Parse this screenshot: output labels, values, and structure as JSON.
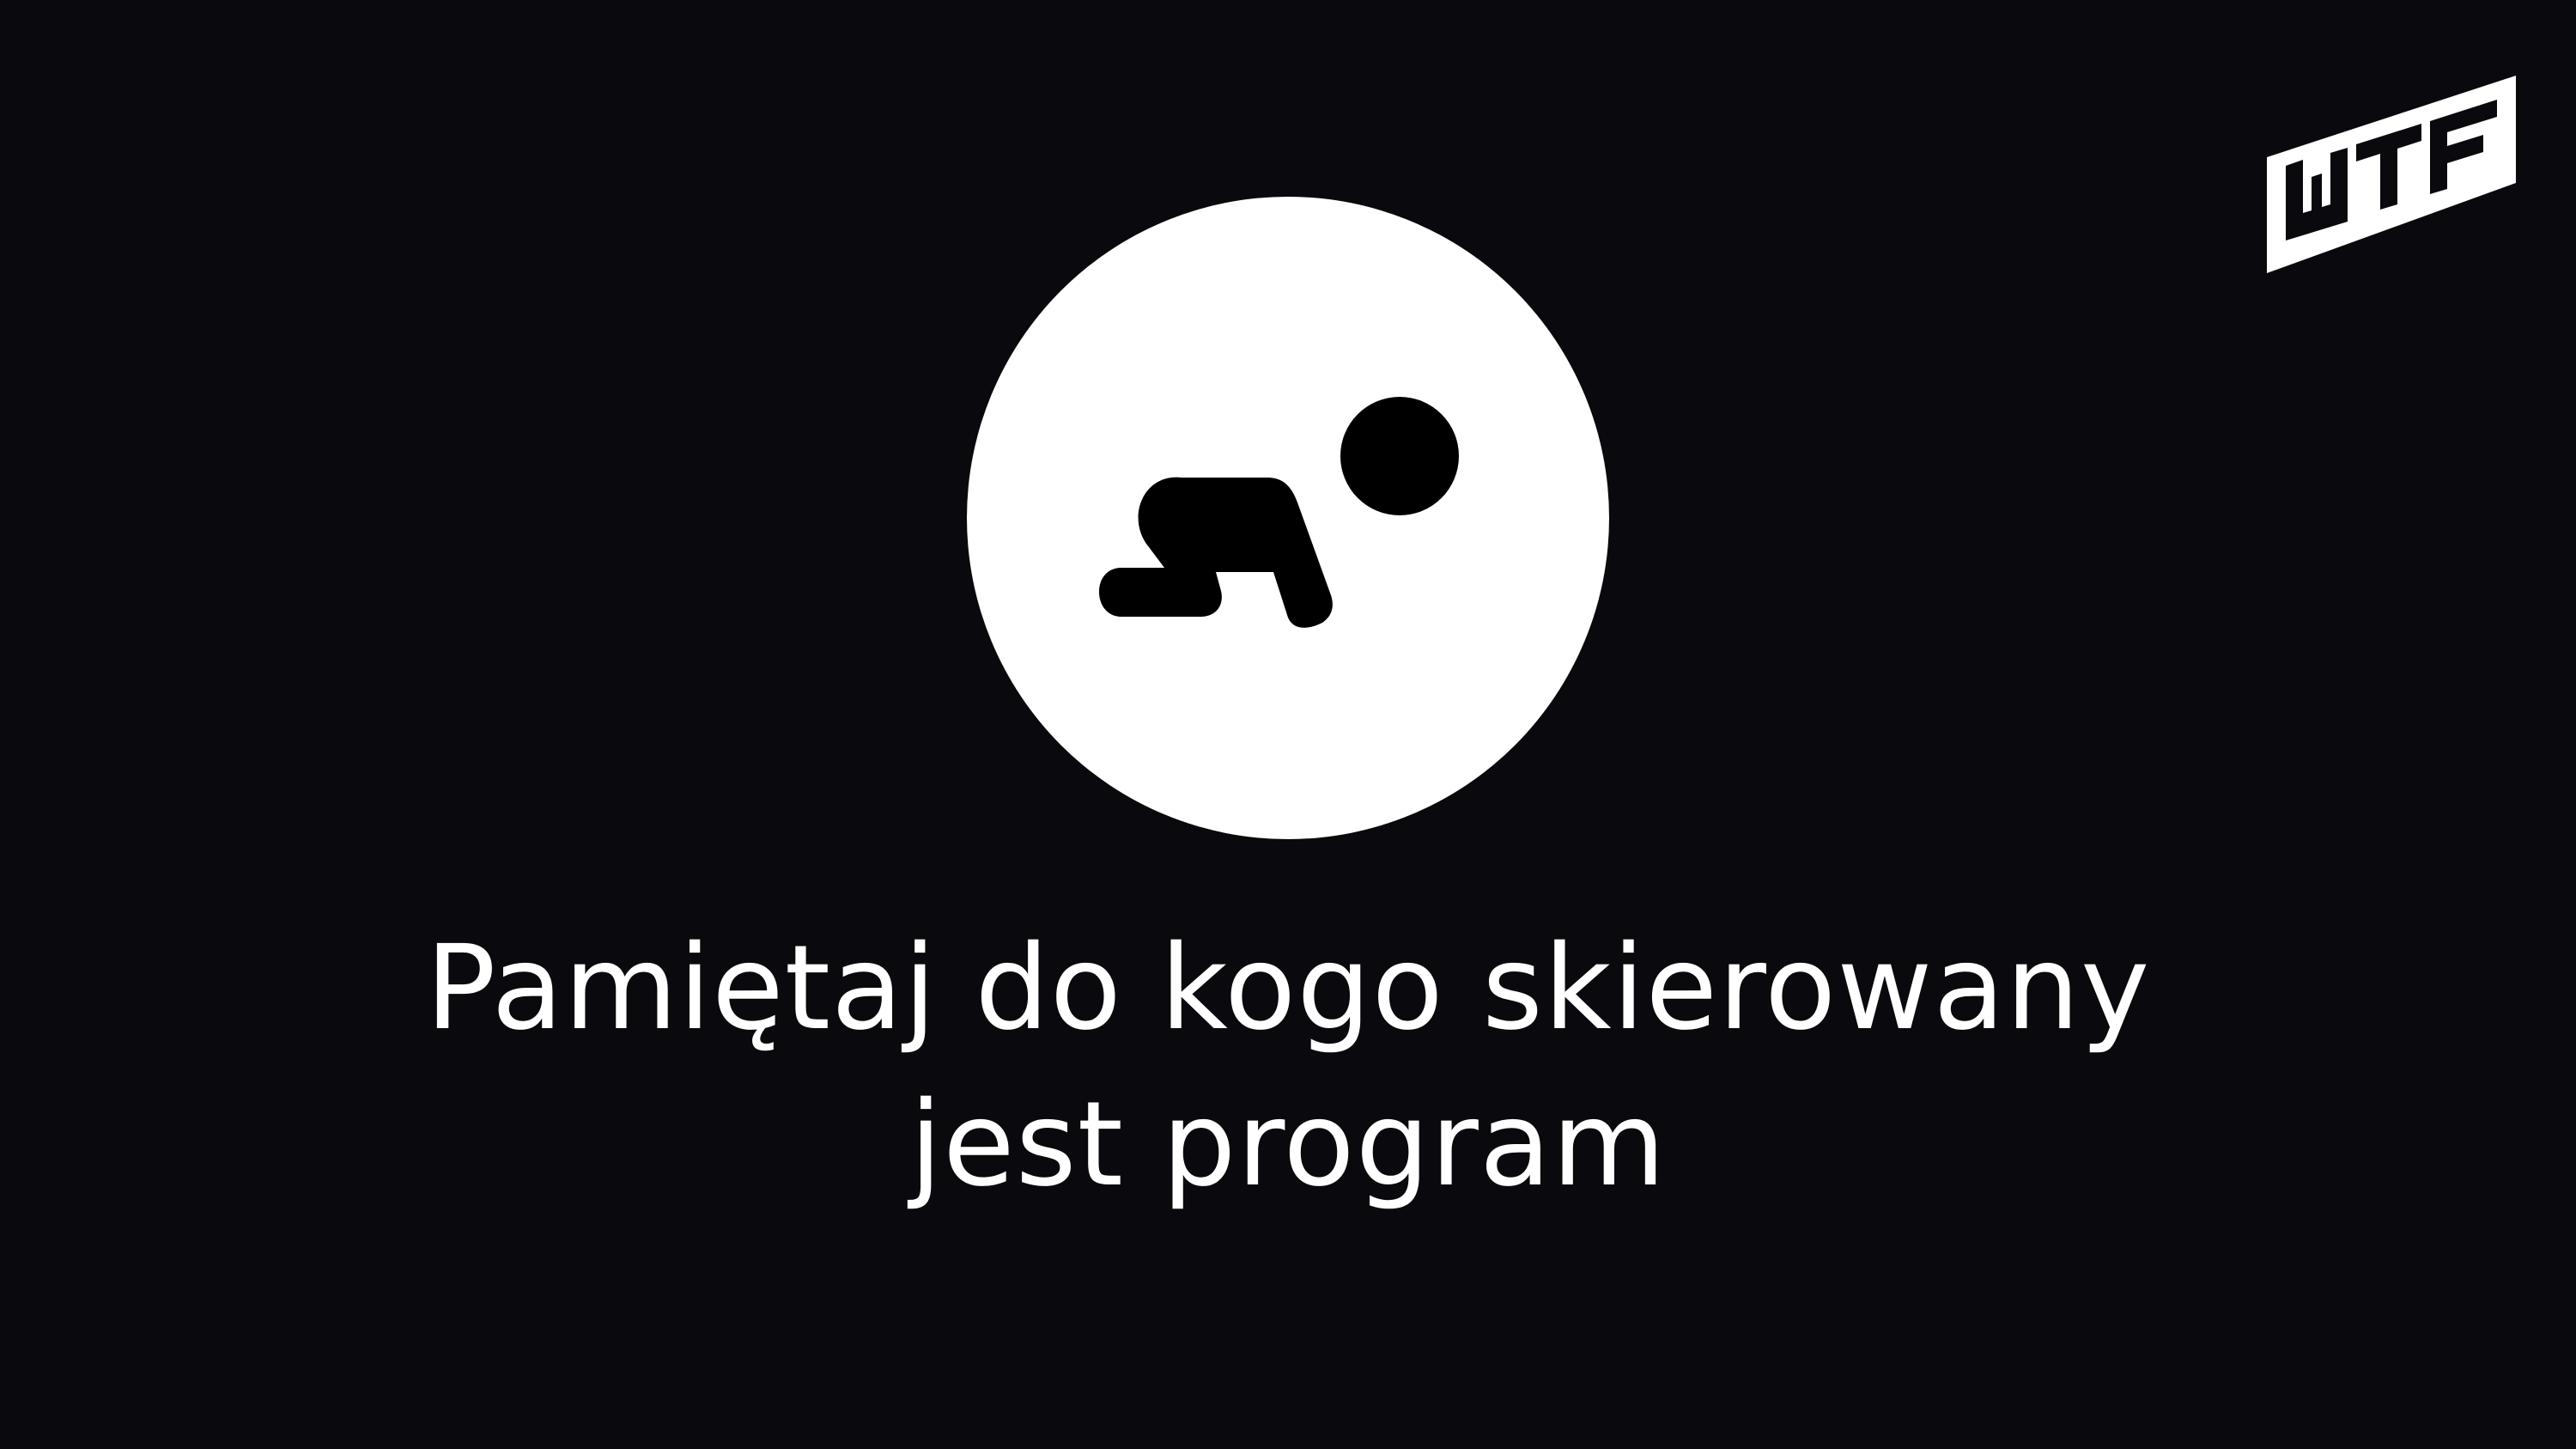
{
  "screen": {
    "background_color": "#0a090d",
    "foreground_color": "#ffffff"
  },
  "brand": {
    "logo_text": "WTF",
    "icon": "wtf-logo-icon"
  },
  "badge": {
    "icon": "crawling-baby-icon",
    "circle_color": "#ffffff",
    "icon_color": "#000000"
  },
  "message": {
    "line1": "Pamiętaj do kogo skierowany",
    "line2": "jest program"
  }
}
